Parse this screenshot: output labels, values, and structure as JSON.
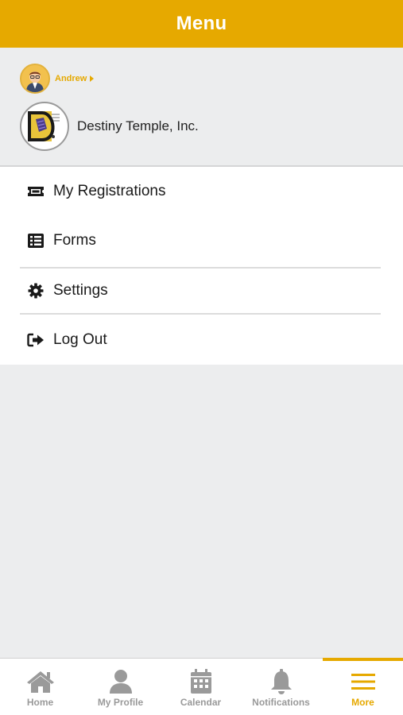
{
  "header": {
    "title": "Menu"
  },
  "profile": {
    "user_name": "Andrew",
    "org_name": "Destiny Temple, Inc."
  },
  "menu": {
    "items": [
      {
        "label": "My Registrations",
        "icon": "ticket-icon"
      },
      {
        "label": "Forms",
        "icon": "list-icon"
      },
      {
        "label": "Settings",
        "icon": "gear-icon"
      },
      {
        "label": "Log Out",
        "icon": "sign-out-icon"
      }
    ]
  },
  "tabbar": {
    "tabs": [
      {
        "label": "Home",
        "icon": "home-icon"
      },
      {
        "label": "My Profile",
        "icon": "user-icon"
      },
      {
        "label": "Calendar",
        "icon": "calendar-icon"
      },
      {
        "label": "Notifications",
        "icon": "bell-icon"
      },
      {
        "label": "More",
        "icon": "hamburger-icon",
        "active": true
      }
    ]
  },
  "colors": {
    "accent": "#e6a900",
    "background": "#ecedee",
    "inactive": "#9a9a9a"
  }
}
